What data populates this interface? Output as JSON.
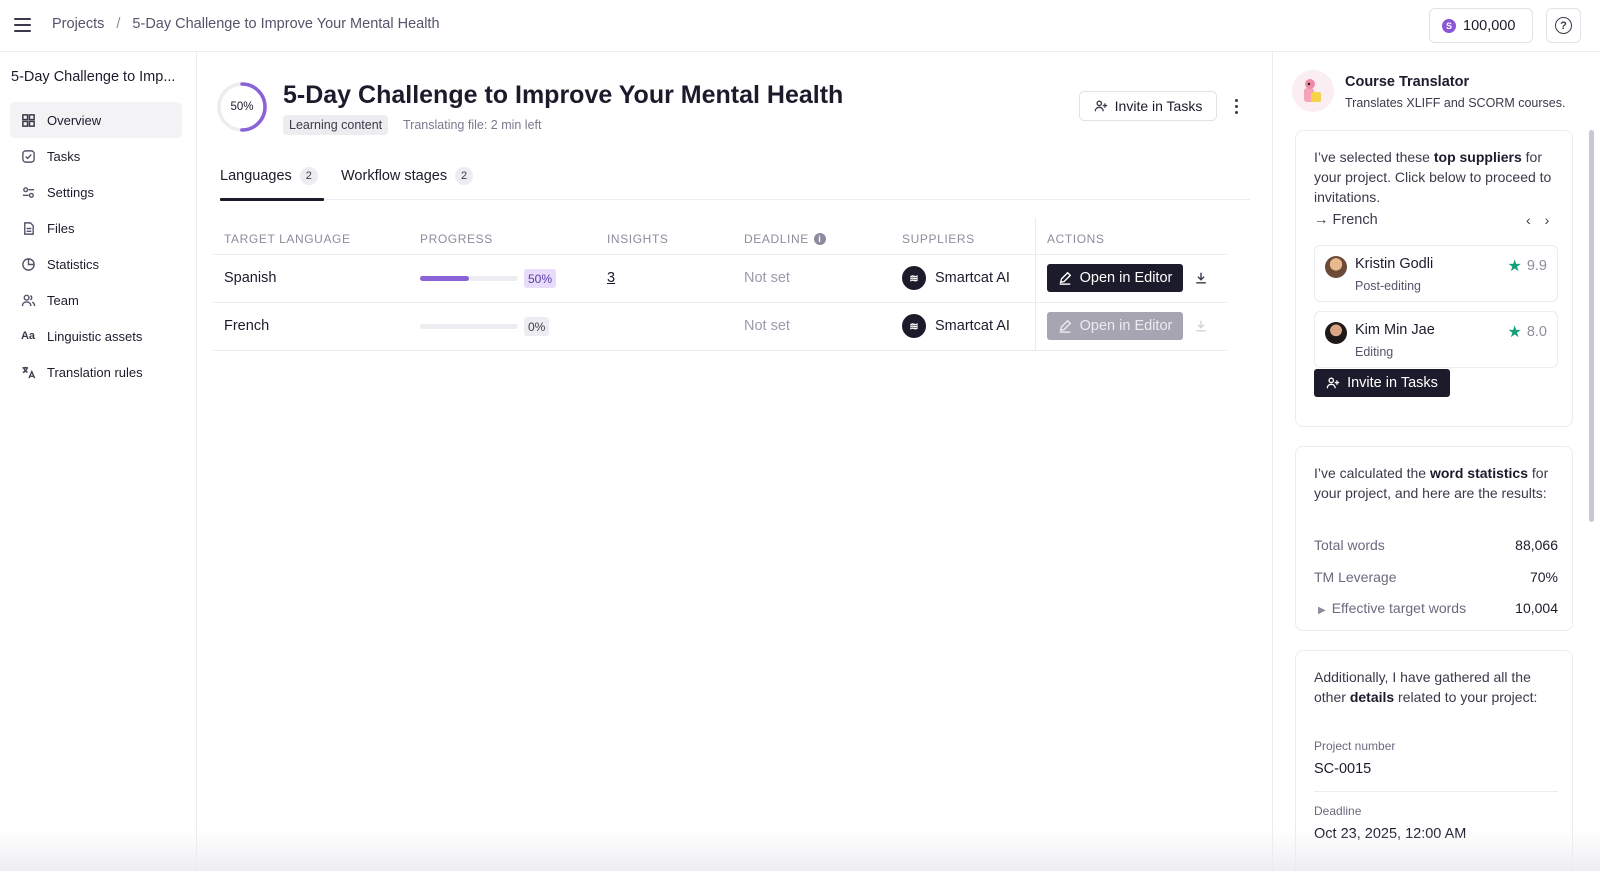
{
  "breadcrumbs": {
    "root": "Projects",
    "separator": "/",
    "current": "5-Day Challenge to Improve Your Mental Health"
  },
  "credits": {
    "coin": "S",
    "amount": "100,000"
  },
  "sidebar": {
    "title": "5-Day Challenge to Imp...",
    "items": [
      {
        "label": "Overview",
        "icon": "grid-icon"
      },
      {
        "label": "Tasks",
        "icon": "check-square-icon"
      },
      {
        "label": "Settings",
        "icon": "sliders-icon"
      },
      {
        "label": "Files",
        "icon": "file-icon"
      },
      {
        "label": "Statistics",
        "icon": "pie-chart-icon"
      },
      {
        "label": "Team",
        "icon": "users-icon"
      },
      {
        "label": "Linguistic assets",
        "icon": "text-icon"
      },
      {
        "label": "Translation rules",
        "icon": "translate-icon"
      }
    ]
  },
  "project": {
    "progress_label": "50%",
    "progress": 0.5,
    "title": "5-Day Challenge to Improve Your Mental Health",
    "tag": "Learning content",
    "status": "Translating file: 2 min left",
    "invite_label": "Invite in Tasks"
  },
  "tabs": [
    {
      "label": "Languages",
      "count": "2"
    },
    {
      "label": "Workflow stages",
      "count": "2"
    }
  ],
  "table": {
    "headers": {
      "language": "TARGET LANGUAGE",
      "progress": "PROGRESS",
      "insights": "INSIGHTS",
      "deadline": "DEADLINE",
      "suppliers": "SUPPLIERS",
      "actions": "ACTIONS"
    },
    "rows": [
      {
        "language": "Spanish",
        "progress": 0.5,
        "progress_label": "50%",
        "insights": "3",
        "deadline": "Not set",
        "supplier": "Smartcat AI",
        "action": "Open in Editor"
      },
      {
        "language": "French",
        "progress": 0,
        "progress_label": "0%",
        "insights": "",
        "deadline": "Not set",
        "supplier": "Smartcat AI",
        "action": "Open in Editor"
      }
    ]
  },
  "assistant": {
    "name": "Course Translator",
    "description": "Translates XLIFF and SCORM courses.",
    "suppliers_card": {
      "text_pre": "I’ve selected these ",
      "text_bold": "top suppliers",
      "text_post": " for your project. Click below to proceed to invitations.",
      "language": "French",
      "suppliers": [
        {
          "name": "Kristin Godli",
          "role": "Post-editing",
          "score": "9.9"
        },
        {
          "name": "Kim Min Jae",
          "role": "Editing",
          "score": "8.0"
        }
      ],
      "invite_label": "Invite in Tasks"
    },
    "stats_card": {
      "text_pre": "I’ve calculated the ",
      "text_bold": "word statistics",
      "text_post": " for your project, and here are the results:",
      "rows": [
        {
          "label": "Total words",
          "value": "88,066"
        },
        {
          "label": "TM Leverage",
          "value": "70%"
        },
        {
          "label": "Effective target words",
          "value": "10,004"
        }
      ]
    },
    "details_card": {
      "text_pre": "Additionally, I have gathered all the other ",
      "text_bold": "details",
      "text_post": " related to your project:",
      "fields": [
        {
          "label": "Project number",
          "value": "SC-0015"
        },
        {
          "label": "Deadline",
          "value": "Oct 23, 2025, 12:00 AM"
        }
      ]
    }
  },
  "colors": {
    "accent": "#8b62d8",
    "dark": "#1c1b2b",
    "star": "#11a07a"
  }
}
